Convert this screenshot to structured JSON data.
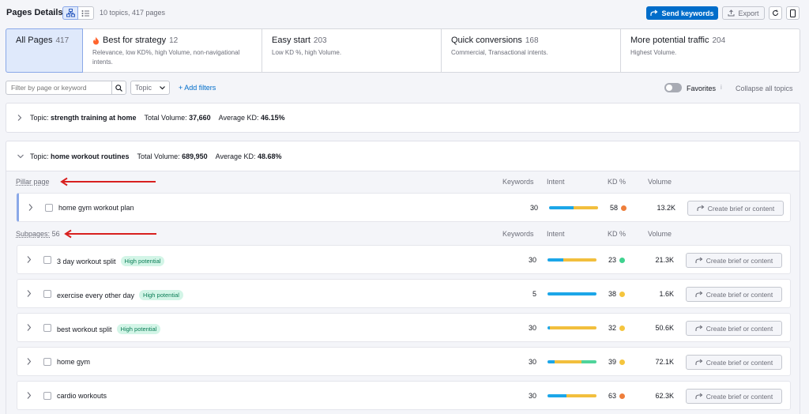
{
  "header": {
    "title": "Pages Details",
    "subtitle": "10 topics, 417 pages",
    "send_keywords": "Send keywords",
    "export": "Export"
  },
  "strategies": [
    {
      "name": "All Pages",
      "count": "417",
      "desc": ""
    },
    {
      "name": "Best for strategy",
      "count": "12",
      "desc": "Relevance, low KD%, high Volume, non-navigational intents."
    },
    {
      "name": "Easy start",
      "count": "203",
      "desc": "Low KD %, high Volume."
    },
    {
      "name": "Quick conversions",
      "count": "168",
      "desc": "Commercial, Transactional intents."
    },
    {
      "name": "More potential traffic",
      "count": "204",
      "desc": "Highest Volume."
    }
  ],
  "filters": {
    "search_placeholder": "Filter by page or keyword",
    "topic_label": "Topic",
    "add_filters": "+ Add filters",
    "favorites": "Favorites",
    "info": "i",
    "collapse_all": "Collapse all topics"
  },
  "topics": [
    {
      "prefix": "Topic:",
      "name": "strength training at home",
      "volume_label": "Total Volume:",
      "volume": "37,660",
      "kd_label": "Average KD:",
      "kd": "46.15%"
    },
    {
      "prefix": "Topic:",
      "name": "home workout routines",
      "volume_label": "Total Volume:",
      "volume": "689,950",
      "kd_label": "Average KD:",
      "kd": "48.68%"
    }
  ],
  "columns": {
    "keywords": "Keywords",
    "intent": "Intent",
    "kd": "KD %",
    "volume": "Volume"
  },
  "pillar_label": "Pillar page",
  "subpages_label": "Subpages:",
  "subpages_count": "56",
  "brief_label": "Create brief or content",
  "colors": {
    "blue": "#1ca6e8",
    "yellow": "#f2bf3d",
    "green": "#4fd49b",
    "orange": "#ee7e3b",
    "kd_green": "#3fd28f",
    "kd_yellow": "#f5c53d",
    "arrow": "#d8201f",
    "accent": "#006dca"
  },
  "pillar": {
    "keyword": "home gym workout plan",
    "keywords": "30",
    "kd": "58",
    "kd_color": "orange",
    "volume": "13.2K",
    "intent": [
      {
        "color": "blue",
        "share": 0.5
      },
      {
        "color": "yellow",
        "share": 0.5
      }
    ]
  },
  "subpages": [
    {
      "keyword": "3 day workout split",
      "badge": "High potential",
      "keywords": "30",
      "kd": "23",
      "kd_color": "kd_green",
      "volume": "21.3K",
      "intent": [
        {
          "color": "blue",
          "share": 0.33
        },
        {
          "color": "yellow",
          "share": 0.67
        }
      ]
    },
    {
      "keyword": "exercise every other day",
      "badge": "High potential",
      "keywords": "5",
      "kd": "38",
      "kd_color": "kd_yellow",
      "volume": "1.6K",
      "intent": [
        {
          "color": "blue",
          "share": 1.0
        }
      ]
    },
    {
      "keyword": "best workout split",
      "badge": "High potential",
      "keywords": "30",
      "kd": "32",
      "kd_color": "kd_yellow",
      "volume": "50.6K",
      "intent": [
        {
          "color": "blue",
          "share": 0.05
        },
        {
          "color": "yellow",
          "share": 0.95
        }
      ]
    },
    {
      "keyword": "home gym",
      "badge": "",
      "keywords": "30",
      "kd": "39",
      "kd_color": "kd_yellow",
      "volume": "72.1K",
      "intent": [
        {
          "color": "blue",
          "share": 0.15
        },
        {
          "color": "yellow",
          "share": 0.55
        },
        {
          "color": "green",
          "share": 0.3
        }
      ]
    },
    {
      "keyword": "cardio workouts",
      "badge": "",
      "keywords": "30",
      "kd": "63",
      "kd_color": "orange",
      "volume": "62.3K",
      "intent": [
        {
          "color": "blue",
          "share": 0.38
        },
        {
          "color": "yellow",
          "share": 0.62
        }
      ]
    }
  ]
}
